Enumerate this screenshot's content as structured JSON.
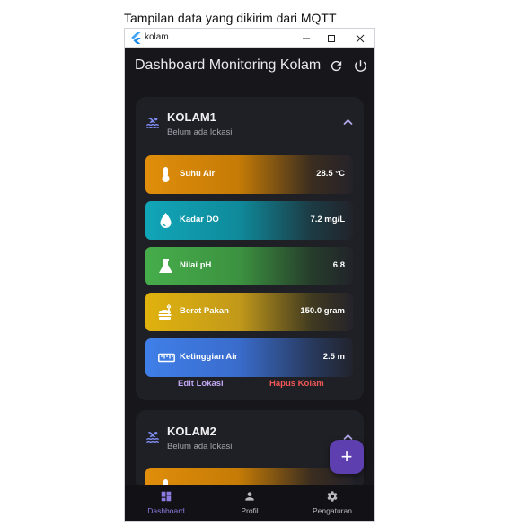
{
  "caption": "Tampilan data yang dikirim dari MQTT",
  "window": {
    "title": "kolam",
    "minimize_icon": "minimize-icon",
    "maximize_icon": "maximize-icon",
    "close_icon": "close-icon"
  },
  "appbar": {
    "title": "Dashboard Monitoring Kolam",
    "refresh_icon": "refresh-icon",
    "power_icon": "power-icon"
  },
  "colors": {
    "background": "#16161b",
    "card": "#1f1f26",
    "accent": "#8d7ae0",
    "fab": "#5d3fb0",
    "delete": "#f05757",
    "edit": "#bfa8f2"
  },
  "kolam": [
    {
      "name": "KOLAM1",
      "location": "Belum ada lokasi",
      "sensors": [
        {
          "label": "Suhu Air",
          "value": "28.5 °C",
          "icon": "thermometer-icon"
        },
        {
          "label": "Kadar DO",
          "value": "7.2 mg/L",
          "icon": "water-drop-icon"
        },
        {
          "label": "Nilai pH",
          "value": "6.8",
          "icon": "flask-icon"
        },
        {
          "label": "Berat Pakan",
          "value": "150.0 gram",
          "icon": "feed-icon"
        },
        {
          "label": "Ketinggian Air",
          "value": "2.5 m",
          "icon": "ruler-icon"
        }
      ],
      "actions": {
        "edit": "Edit Lokasi",
        "delete": "Hapus Kolam"
      }
    },
    {
      "name": "KOLAM2",
      "location": "Belum ada lokasi"
    }
  ],
  "fab_label": "+",
  "nav": [
    {
      "label": "Dashboard",
      "icon": "dashboard-icon",
      "active": true
    },
    {
      "label": "Profil",
      "icon": "person-icon",
      "active": false
    },
    {
      "label": "Pengaturan",
      "icon": "settings-icon",
      "active": false
    }
  ]
}
